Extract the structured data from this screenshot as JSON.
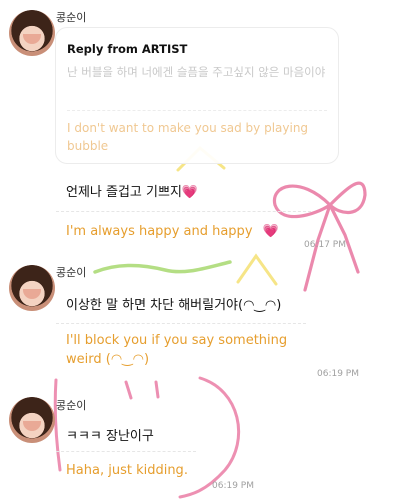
{
  "messages": [
    {
      "sender": "콩순이",
      "reply": {
        "title": "Reply from ARTIST",
        "original_text": "난 버블을 하며 너에겐 슬픔을 주고싶지 않은 마음이야",
        "translation": "I don't want to make you sad by playing bubble"
      },
      "text": "언제나 즐겁고 기쁘지",
      "text_emoji": "💗",
      "translation": "I'm always happy and happy",
      "translation_emoji": "💗",
      "time": "06:17 PM"
    },
    {
      "sender": "콩순이",
      "text": "이상한 말 하면 차단 해버릴거야(◠‿◠)",
      "translation": "I'll block you if you say something weird (◠‿◠)",
      "time": "06:19 PM"
    },
    {
      "sender": "콩순이",
      "text": "ㅋㅋㅋ 장난이구",
      "translation": "Haha, just kidding.",
      "time": "06:19 PM"
    }
  ],
  "colors": {
    "translation": "#e69e2e",
    "reply_translation": "#f0c892",
    "muted_text": "#c9c9c9",
    "timestamp": "#a0a0a0",
    "doodle_pink": "#e8749f",
    "doodle_green": "#a7d86e",
    "doodle_yellow": "#f5e27a"
  },
  "icons": [
    "avatar",
    "heart-emoji"
  ]
}
